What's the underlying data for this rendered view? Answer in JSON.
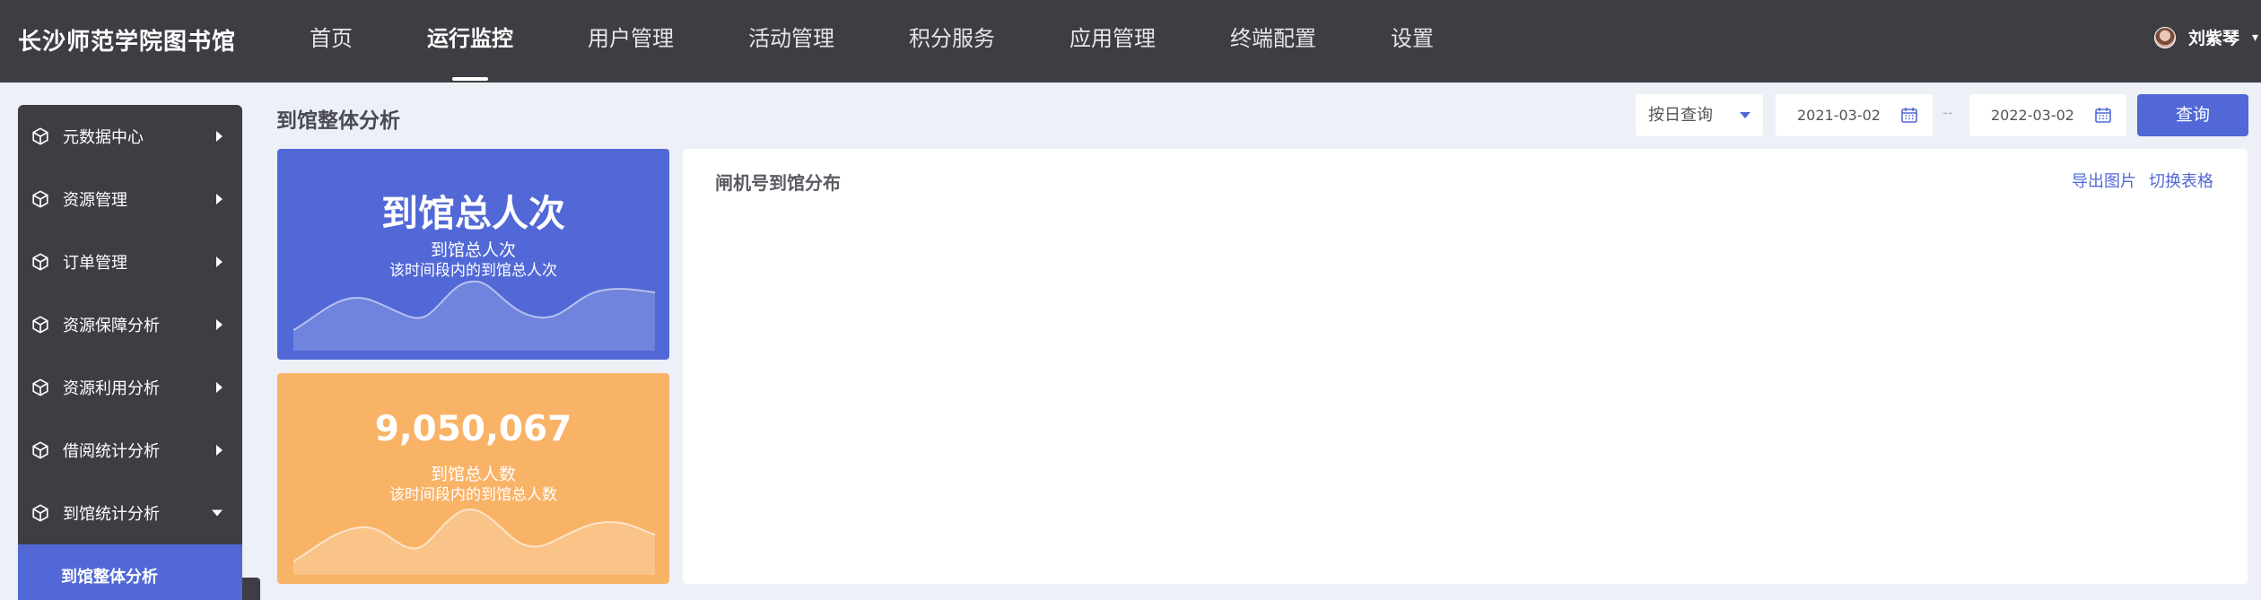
{
  "app": {
    "brand": "长沙师范学院图书馆"
  },
  "nav": [
    {
      "label": "首页",
      "active": false
    },
    {
      "label": "运行监控",
      "active": true
    },
    {
      "label": "用户管理",
      "active": false
    },
    {
      "label": "活动管理",
      "active": false
    },
    {
      "label": "积分服务",
      "active": false
    },
    {
      "label": "应用管理",
      "active": false
    },
    {
      "label": "终端配置",
      "active": false
    },
    {
      "label": "设置",
      "active": false
    }
  ],
  "user": {
    "name": "刘紫琴"
  },
  "sidebar": {
    "items": [
      {
        "label": "元数据中心",
        "icon": "cube-icon",
        "expanded": false
      },
      {
        "label": "资源管理",
        "icon": "cube-icon",
        "expanded": false
      },
      {
        "label": "订单管理",
        "icon": "cube-icon",
        "expanded": false
      },
      {
        "label": "资源保障分析",
        "icon": "cube-icon",
        "expanded": false
      },
      {
        "label": "资源利用分析",
        "icon": "cube-icon",
        "expanded": false
      },
      {
        "label": "借阅统计分析",
        "icon": "cube-icon",
        "expanded": false
      },
      {
        "label": "到馆统计分析",
        "icon": "cube-icon",
        "expanded": true
      }
    ],
    "active_sub": "到馆整体分析"
  },
  "page": {
    "title": "到馆整体分析"
  },
  "filters": {
    "mode": "按日查询",
    "start_date": "2021-03-02",
    "end_date": "2022-03-02",
    "separator": "--",
    "query_label": "查询"
  },
  "cards": {
    "visits": {
      "big": "到馆总人次",
      "label": "到馆总人次",
      "desc": "该时间段内的到馆总人次",
      "color": "#5168d6"
    },
    "people": {
      "big": "9,050,067",
      "label": "到馆总人数",
      "desc": "该时间段内的到馆总人数",
      "color": "#f9b366"
    }
  },
  "panel": {
    "title": "闸机号到馆分布",
    "export_label": "导出图片",
    "toggle_label": "切换表格"
  },
  "colors": {
    "accent": "#5168d6",
    "topbar": "#3d3d43",
    "background": "#edf0f6"
  }
}
